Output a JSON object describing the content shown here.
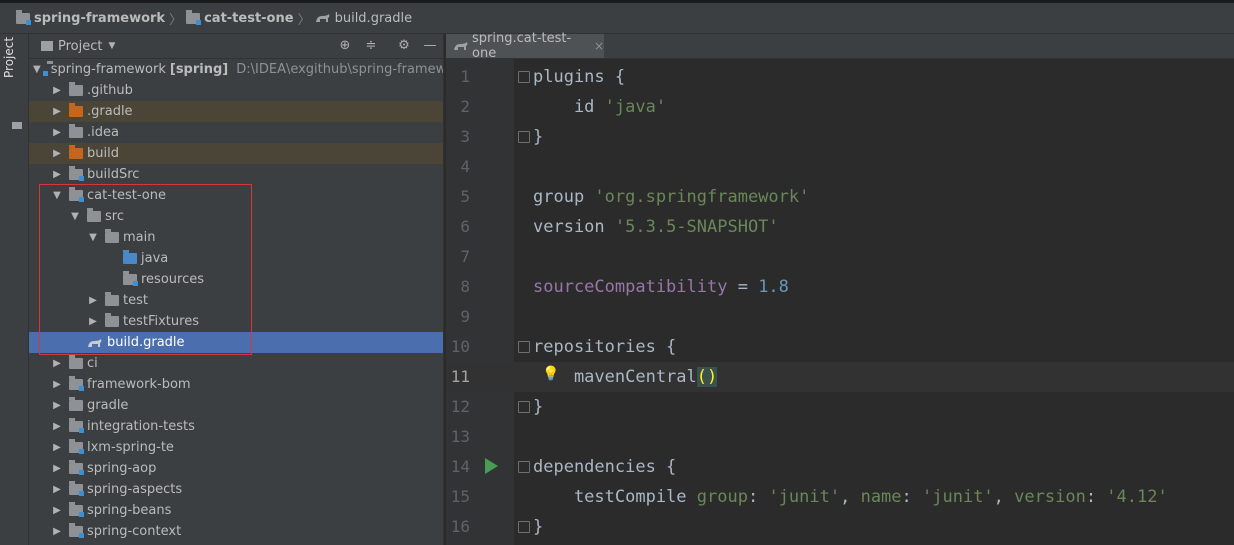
{
  "breadcrumb": {
    "items": [
      {
        "label": "spring-framework",
        "icon": "module-folder-icon"
      },
      {
        "label": "cat-test-one",
        "icon": "module-folder-icon"
      },
      {
        "label": "build.gradle",
        "icon": "gradle-icon"
      }
    ]
  },
  "side_strip": {
    "label": "Project"
  },
  "project_panel": {
    "title": "Project",
    "tools": [
      "locate-icon",
      "collapse-icon",
      "gear-icon",
      "minimize-icon"
    ]
  },
  "tree": {
    "root": {
      "name": "spring-framework",
      "tag": "[spring]",
      "path": "D:\\IDEA\\exgithub\\spring-framework"
    },
    "items": [
      {
        "label": ".github",
        "arrow": "right",
        "icon": "folder"
      },
      {
        "label": ".gradle",
        "arrow": "right",
        "icon": "folder-orange",
        "excluded": true
      },
      {
        "label": ".idea",
        "arrow": "right",
        "icon": "folder"
      },
      {
        "label": "build",
        "arrow": "right",
        "icon": "folder-orange",
        "excluded": true
      },
      {
        "label": "buildSrc",
        "arrow": "right",
        "icon": "module-folder"
      },
      {
        "label": "cat-test-one",
        "arrow": "down",
        "icon": "module-folder"
      },
      {
        "label": "src",
        "arrow": "down",
        "icon": "folder"
      },
      {
        "label": "main",
        "arrow": "down",
        "icon": "folder"
      },
      {
        "label": "java",
        "arrow": "none",
        "icon": "source-folder"
      },
      {
        "label": "resources",
        "arrow": "none",
        "icon": "resources-folder"
      },
      {
        "label": "test",
        "arrow": "right",
        "icon": "folder"
      },
      {
        "label": "testFixtures",
        "arrow": "right",
        "icon": "folder"
      },
      {
        "label": "build.gradle",
        "arrow": "none",
        "icon": "gradle",
        "selected": true
      },
      {
        "label": "ci",
        "arrow": "right",
        "icon": "folder"
      },
      {
        "label": "framework-bom",
        "arrow": "right",
        "icon": "module-folder"
      },
      {
        "label": "gradle",
        "arrow": "right",
        "icon": "folder"
      },
      {
        "label": "integration-tests",
        "arrow": "right",
        "icon": "module-folder"
      },
      {
        "label": "lxm-spring-te",
        "arrow": "right",
        "icon": "module-folder"
      },
      {
        "label": "spring-aop",
        "arrow": "right",
        "icon": "module-folder"
      },
      {
        "label": "spring-aspects",
        "arrow": "right",
        "icon": "module-folder"
      },
      {
        "label": "spring-beans",
        "arrow": "right",
        "icon": "module-folder"
      },
      {
        "label": "spring-context",
        "arrow": "right",
        "icon": "module-folder"
      }
    ]
  },
  "editor": {
    "tab": {
      "label": "spring.cat-test-one",
      "close": "×"
    },
    "current_line": 11,
    "lines": [
      {
        "n": "1",
        "code": "plugins {"
      },
      {
        "n": "2",
        "code": "    id 'java'"
      },
      {
        "n": "3",
        "code": "}"
      },
      {
        "n": "4",
        "code": ""
      },
      {
        "n": "5",
        "code": "group 'org.springframework'"
      },
      {
        "n": "6",
        "code": "version '5.3.5-SNAPSHOT'"
      },
      {
        "n": "7",
        "code": ""
      },
      {
        "n": "8",
        "code": "sourceCompatibility = 1.8"
      },
      {
        "n": "9",
        "code": ""
      },
      {
        "n": "10",
        "code": "repositories {"
      },
      {
        "n": "11",
        "code": "    mavenCentral()"
      },
      {
        "n": "12",
        "code": "}"
      },
      {
        "n": "13",
        "code": ""
      },
      {
        "n": "14",
        "code": "dependencies {"
      },
      {
        "n": "15",
        "code": "    testCompile group: 'junit', name: 'junit', version: '4.12'"
      },
      {
        "n": "16",
        "code": "}"
      }
    ]
  },
  "colors": {
    "selection": "#4b6eaf",
    "highlight_box": "#d43838",
    "string": "#6a8759",
    "property": "#9876aa",
    "number": "#6897bb"
  }
}
